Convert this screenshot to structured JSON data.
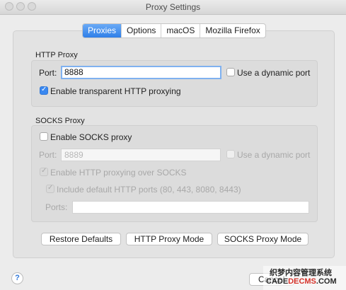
{
  "window": {
    "title": "Proxy Settings"
  },
  "tabs": [
    {
      "label": "Proxies",
      "active": true
    },
    {
      "label": "Options",
      "active": false
    },
    {
      "label": "macOS",
      "active": false
    },
    {
      "label": "Mozilla Firefox",
      "active": false
    }
  ],
  "http_proxy": {
    "group_title": "HTTP Proxy",
    "port_label": "Port:",
    "port_value": "8888",
    "dynamic_port_label": "Use a dynamic port",
    "dynamic_port_checked": false,
    "transparent_label": "Enable transparent HTTP proxying",
    "transparent_checked": true
  },
  "socks_proxy": {
    "group_title": "SOCKS Proxy",
    "enable_label": "Enable SOCKS proxy",
    "enable_checked": false,
    "port_label": "Port:",
    "port_placeholder": "8889",
    "dynamic_port_label": "Use a dynamic port",
    "http_over_socks_label": "Enable HTTP proxying over SOCKS",
    "http_over_socks_checked": true,
    "include_default_ports_label": "Include default HTTP ports (80, 443, 8080, 8443)",
    "include_default_ports_checked": true,
    "ports_label": "Ports:",
    "ports_value": ""
  },
  "buttons": {
    "restore_defaults": "Restore Defaults",
    "http_proxy_mode": "HTTP Proxy Mode",
    "socks_proxy_mode": "SOCKS Proxy Mode"
  },
  "footer": {
    "help_label": "?",
    "cancel_label": "Cancel"
  },
  "watermark": {
    "line1": "织梦内容管理系统",
    "line2_prefix": "CADE",
    "line2_accent": "DECMS",
    "line2_suffix": ".COM"
  },
  "colors": {
    "accent": "#2f7fe8",
    "window_bg": "#ececec",
    "group_bg": "#dcdcdc"
  }
}
